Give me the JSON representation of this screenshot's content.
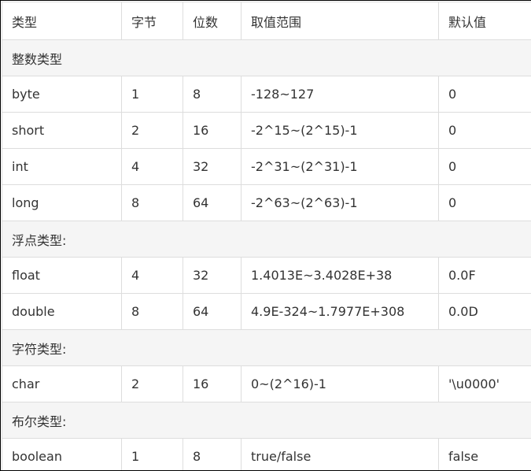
{
  "table": {
    "headers": [
      "类型",
      "字节",
      "位数",
      "取值范围",
      "默认值"
    ],
    "groups": [
      {
        "label": "整数类型",
        "rows": [
          [
            "byte",
            "1",
            "8",
            "-128~127",
            "0"
          ],
          [
            "short",
            "2",
            "16",
            "-2^15~(2^15)-1",
            "0"
          ],
          [
            "int",
            "4",
            "32",
            "-2^31~(2^31)-1",
            "0"
          ],
          [
            "long",
            "8",
            "64",
            "-2^63~(2^63)-1",
            "0"
          ]
        ]
      },
      {
        "label": "浮点类型:",
        "rows": [
          [
            "float",
            "4",
            "32",
            "1.4013E~3.4028E+38",
            "0.0F"
          ],
          [
            "double",
            "8",
            "64",
            "4.9E-324~1.7977E+308",
            "0.0D"
          ]
        ]
      },
      {
        "label": "字符类型:",
        "rows": [
          [
            "char",
            "2",
            "16",
            "0~(2^16)-1",
            "'\\u0000'"
          ]
        ]
      },
      {
        "label": "布尔类型:",
        "rows": [
          [
            "boolean",
            "1",
            "8",
            "true/false",
            "false"
          ]
        ]
      }
    ]
  },
  "colors": {
    "border": "#dddddd",
    "group_background": "#f5f5f5",
    "text": "#333333"
  }
}
